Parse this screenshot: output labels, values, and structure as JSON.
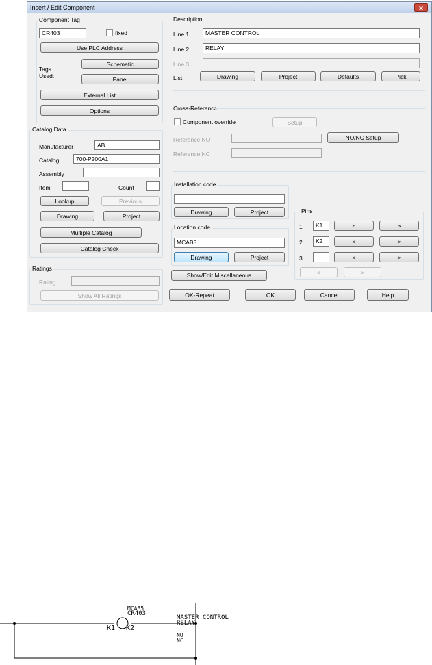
{
  "dialog": {
    "title": "Insert / Edit Component",
    "close_label": "✕"
  },
  "component_tag": {
    "group_title": "Component Tag",
    "tag_value": "CR403",
    "fixed_label": "fixed",
    "use_plc_label": "Use PLC Address",
    "tags_used_label_line1": "Tags",
    "tags_used_label_line2": "Used:",
    "schematic_label": "Schematic",
    "panel_label": "Panel",
    "external_list_label": "External List",
    "options_label": "Options"
  },
  "catalog_data": {
    "group_title": "Catalog Data",
    "manufacturer_label": "Manufacturer",
    "manufacturer_value": "AB",
    "catalog_label": "Catalog",
    "catalog_value": "700-P200A1",
    "assembly_label": "Assembly",
    "assembly_value": "",
    "item_label": "Item",
    "item_value": "",
    "count_label": "Count",
    "count_value": "",
    "lookup_label": "Lookup",
    "previous_label": "Previous",
    "drawing_label": "Drawing",
    "project_label": "Project",
    "multiple_catalog_label": "Multiple Catalog",
    "catalog_check_label": "Catalog Check"
  },
  "ratings": {
    "group_title": "Ratings",
    "rating_label": "Rating",
    "rating_value": "",
    "show_all_label": "Show All Ratings"
  },
  "description": {
    "group_title": "Description",
    "line1_label": "Line 1",
    "line1_value": "MASTER CONTROL",
    "line2_label": "Line 2",
    "line2_value": "RELAY",
    "line3_label": "Line 3",
    "line3_value": "",
    "list_label": "List:",
    "drawing_label": "Drawing",
    "project_label": "Project",
    "defaults_label": "Defaults",
    "pick_label": "Pick"
  },
  "cross_reference": {
    "group_title": "Cross-Reference",
    "override_label": "Component override",
    "setup_label": "Setup",
    "ref_no_label": "Reference NO",
    "ref_no_value": "",
    "ref_nc_label": "Reference NC",
    "ref_nc_value": "",
    "nonc_setup_label": "NO/NC Setup"
  },
  "installation_code": {
    "group_title": "Installation code",
    "value": "",
    "drawing_label": "Drawing",
    "project_label": "Project"
  },
  "location_code": {
    "group_title": "Location code",
    "value": "MCAB5",
    "drawing_label": "Drawing",
    "project_label": "Project"
  },
  "show_edit_misc_label": "Show/Edit Miscellaneous",
  "pins": {
    "group_title": "Pins",
    "rows": [
      {
        "num": "1",
        "value": "K1"
      },
      {
        "num": "2",
        "value": "K2"
      },
      {
        "num": "3",
        "value": ""
      }
    ],
    "prev_label": "<",
    "next_label": ">"
  },
  "footer": {
    "ok_repeat_label": "OK-Repeat",
    "ok_label": "OK",
    "cancel_label": "Cancel",
    "help_label": "Help"
  },
  "schematic": {
    "location_text": "MCAB5",
    "tag_text": "CR403",
    "pin1_text": "K1",
    "pin2_text": "K2",
    "desc_line1": "MASTER CONTROL",
    "desc_line2": "RELAY",
    "no_text": "NO",
    "nc_text": "NC"
  }
}
